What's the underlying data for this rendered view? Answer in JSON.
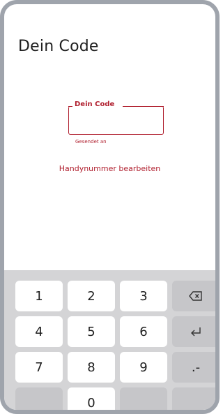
{
  "header": {
    "title": "Dein Code"
  },
  "code_field": {
    "label": "Dein Code",
    "value": "",
    "helper": "Gesendet an"
  },
  "actions": {
    "edit_phone": "Handynummer bearbeiten"
  },
  "keyboard": {
    "keys": [
      "1",
      "2",
      "3",
      "4",
      "5",
      "6",
      "7",
      "8",
      "9",
      "0",
      ".-"
    ],
    "icons": {
      "backspace": "backspace-icon",
      "enter": "enter-icon"
    }
  }
}
